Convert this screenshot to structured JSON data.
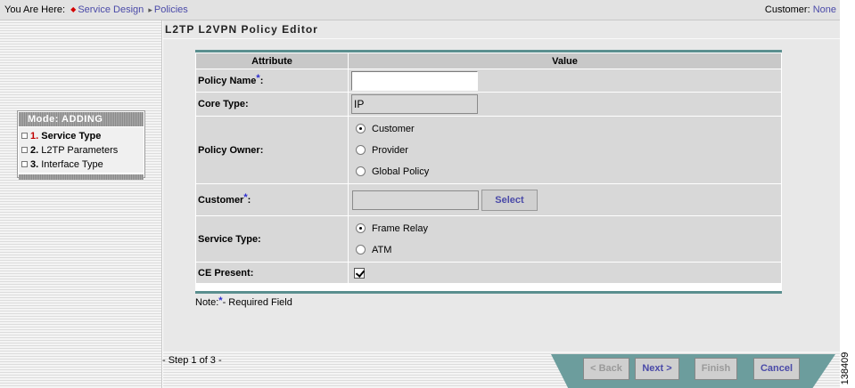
{
  "breadcrumb": {
    "prefix": "You Are Here:",
    "items": [
      "Service Design",
      "Policies"
    ]
  },
  "customer_info": {
    "label": "Customer:",
    "value": "None"
  },
  "page_title": "L2TP L2VPN Policy Editor",
  "mode_panel": {
    "title": "Mode: ADDING",
    "steps": [
      {
        "num": "1.",
        "label": "Service Type",
        "active": true
      },
      {
        "num": "2.",
        "label": "L2TP Parameters",
        "active": false
      },
      {
        "num": "3.",
        "label": "Interface Type",
        "active": false
      }
    ]
  },
  "table": {
    "headers": [
      "Attribute",
      "Value"
    ],
    "policy_name": {
      "label": "Policy Name",
      "value": ""
    },
    "core_type": {
      "label": "Core Type:",
      "value": "IP"
    },
    "policy_owner": {
      "label": "Policy Owner:",
      "options": [
        "Customer",
        "Provider",
        "Global Policy"
      ],
      "selected": "Customer"
    },
    "customer": {
      "label": "Customer",
      "value": "",
      "button": "Select"
    },
    "service_type": {
      "label": "Service Type:",
      "options": [
        "Frame Relay",
        "ATM"
      ],
      "selected": "Frame Relay"
    },
    "ce_present": {
      "label": "CE Present:",
      "checked": true
    }
  },
  "required_marker": "*",
  "note": {
    "prefix": "Note:",
    "text": "- Required Field"
  },
  "footer": {
    "step_info": "- Step 1 of 3 -",
    "buttons": {
      "back": "< Back",
      "next": "Next >",
      "finish": "Finish",
      "cancel": "Cancel"
    }
  },
  "image_id": "138409",
  "colors": {
    "accent_teal": "#5a8f8f",
    "link_blue": "#4a4aa8",
    "required_blue": "#2d2dd0",
    "active_step_red": "#c00000"
  }
}
